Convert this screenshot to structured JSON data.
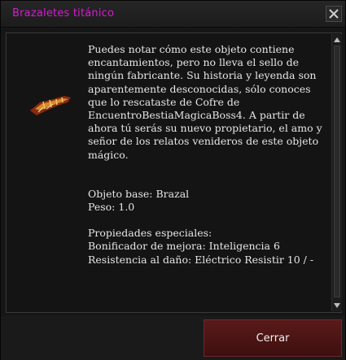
{
  "window": {
    "title": "Brazaletes titánico",
    "title_color": "#d21ed2"
  },
  "item": {
    "icon": "bracelet-icon",
    "description": "Puedes notar cómo este objeto contiene encantamientos, pero no lleva el sello de ningún fabricante. Su historia y leyenda son aparentemente desconocidas, sólo conoces que lo rescataste de Cofre de EncuentroBestiaMagicaBoss4. A partir de ahora tú serás su nuevo propietario, el amo y señor de los relatos venideros de este objeto mágico.",
    "base_object": "Objeto base: Brazal",
    "weight": "Peso: 1.0",
    "special_props_heading": "Propiedades especiales:",
    "props": [
      "Bonificador de mejora: Inteligencia 6",
      "Resistencia al daño: Eléctrico Resistir 10 / -"
    ]
  },
  "footer": {
    "close_label": "Cerrar",
    "close_color": "#4e1515"
  }
}
